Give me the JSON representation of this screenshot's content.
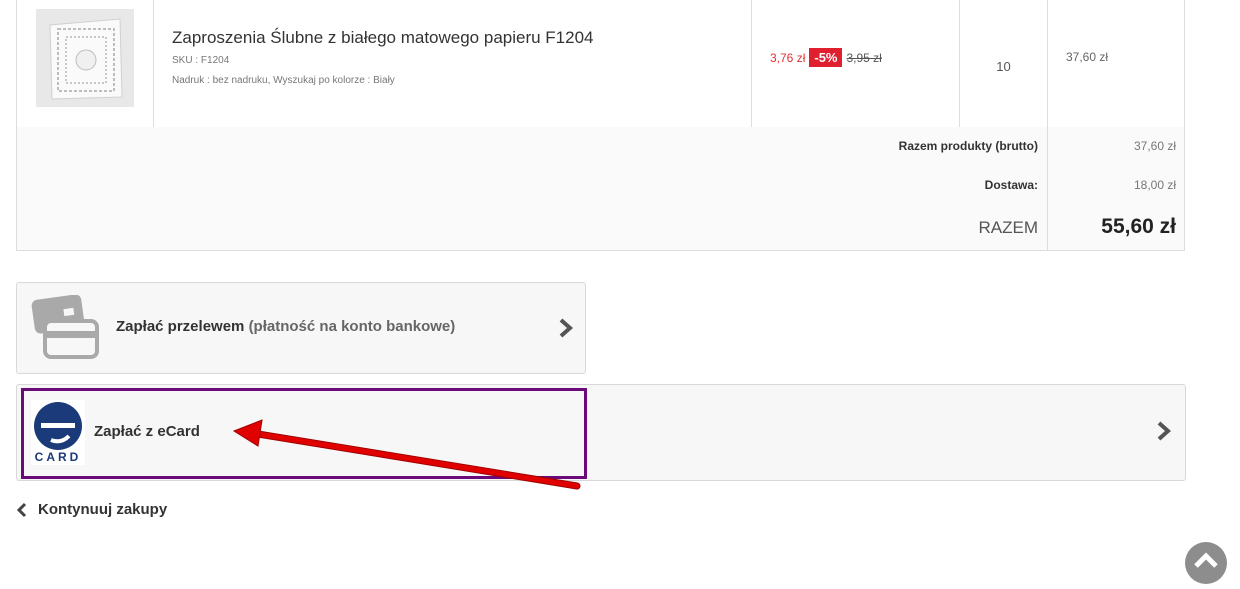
{
  "product": {
    "name": "Zaproszenia Ślubne z białego matowego papieru F1204",
    "sku": "SKU : F1204",
    "attributes": "Nadruk : bez nadruku, Wyszukaj po kolorze : Biały",
    "price_new": "3,76 zł",
    "discount": "-5%",
    "price_old": "3,95 zł",
    "quantity": "10",
    "line_total": "37,60 zł",
    "image_icon": "invitation-card-icon"
  },
  "summary": {
    "products_label": "Razem produkty (brutto)",
    "products_value": "37,60 zł",
    "shipping_label": "Dostawa:",
    "shipping_value": "18,00 zł",
    "total_label": "RAZEM",
    "total_value": "55,60 zł"
  },
  "payment": {
    "transfer_label": "Zapłać przelewem",
    "transfer_sub": "(płatność na konto bankowe)",
    "transfer_icon": "credit-card-icon",
    "ecard_label": "Zapłać z eCard",
    "ecard_logo_text": "CARD",
    "ecard_icon": "ecard-logo"
  },
  "continue_label": "Kontynuuj zakupy",
  "colors": {
    "price_red": "#e63131",
    "discount_bg": "#e0202e",
    "highlight_purple": "#6b0b7a",
    "arrow_red": "#e00000",
    "ecard_blue": "#1b3a7a"
  }
}
